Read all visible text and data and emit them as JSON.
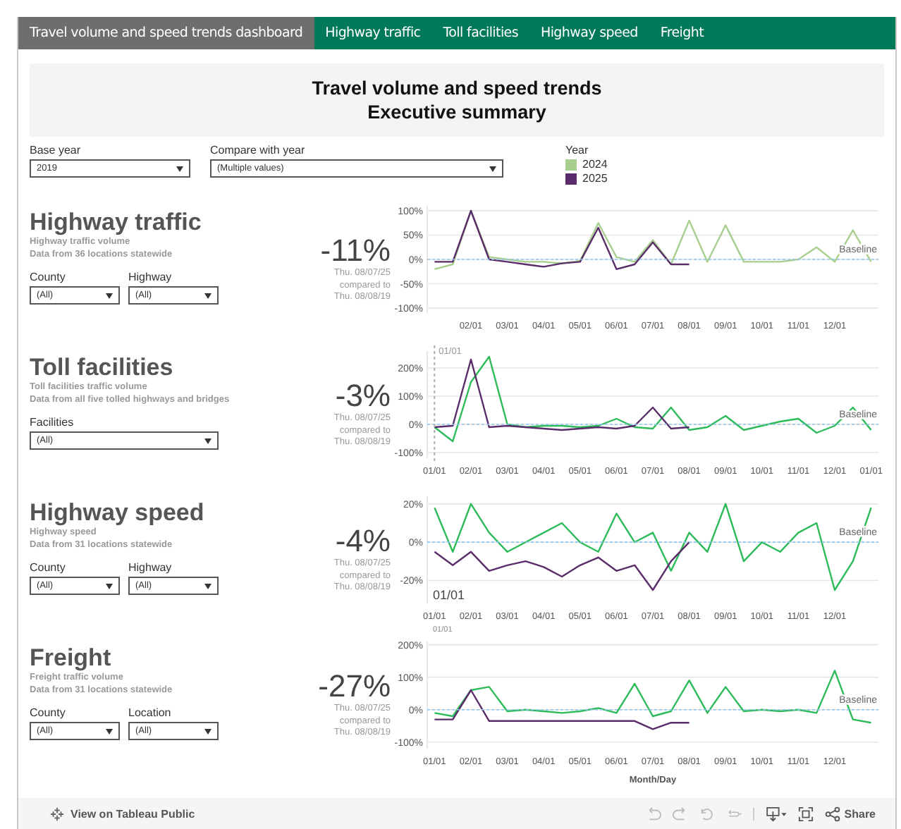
{
  "tabs": [
    {
      "label": "Travel volume and speed trends dashboard",
      "selected": true
    },
    {
      "label": "Highway traffic",
      "selected": false
    },
    {
      "label": "Toll facilities",
      "selected": false
    },
    {
      "label": "Highway speed",
      "selected": false
    },
    {
      "label": "Freight",
      "selected": false
    }
  ],
  "header": {
    "title": "Travel volume and speed trends",
    "subtitle": "Executive summary"
  },
  "filters": [
    {
      "label": "Base year",
      "value": "2019"
    },
    {
      "label": "Compare with year",
      "value": "(Multiple values)"
    }
  ],
  "legend": {
    "title": "Year",
    "items": [
      {
        "label": "2024",
        "color": "#a8cf8e"
      },
      {
        "label": "2025",
        "color": "#5a2d6a"
      }
    ]
  },
  "sections": [
    {
      "title": "Highway traffic",
      "subtitle": "Highway traffic volume",
      "note": "Data from 36 locations statewide",
      "filters": [
        {
          "label": "County",
          "value": "(All)"
        },
        {
          "label": "Highway",
          "value": "(All)"
        }
      ],
      "change": "-11%",
      "compare": [
        "Thu. 08/07/25",
        "compared to",
        "Thu. 08/08/19"
      ],
      "chart_data": {
        "type": "line",
        "grid": true,
        "ylim": [
          -110,
          110
        ],
        "categories": [
          null,
          null,
          "02/01",
          null,
          "03/01",
          null,
          "04/01",
          null,
          "05/01",
          null,
          "06/01",
          null,
          "07/01",
          null,
          "08/01",
          null,
          "09/01",
          null,
          "10/01",
          null,
          "11/01",
          null,
          "12/01",
          null,
          null
        ],
        "yticks": [
          {
            "value": 100,
            "label": "100%"
          },
          {
            "value": 50,
            "label": "50%"
          },
          {
            "value": 0,
            "label": "0%"
          },
          {
            "value": -50,
            "label": "-50%"
          },
          {
            "value": -100,
            "label": "-100%"
          }
        ],
        "series": [
          {
            "color": "#a8cf8e",
            "values": [
              -20,
              -10,
              100,
              5,
              0,
              -5,
              -5,
              -8,
              -3,
              75,
              5,
              -5,
              40,
              -10,
              80,
              -5,
              70,
              -5,
              -5,
              -5,
              0,
              25,
              -5,
              60,
              -5
            ]
          },
          {
            "color": "#5a2d6a",
            "values": [
              -5,
              -5,
              100,
              0,
              -5,
              -10,
              -15,
              -8,
              -5,
              65,
              -20,
              -10,
              35,
              -10,
              -10,
              null,
              null,
              null,
              null,
              null,
              null,
              null,
              null,
              null,
              null
            ]
          }
        ],
        "ref_lines": [
          {
            "axis": "y",
            "value": 0,
            "label": "Baseline"
          }
        ]
      }
    },
    {
      "title": "Toll facilities",
      "subtitle": "Toll facilities traffic volume",
      "note": "Data from all five tolled highways and bridges",
      "filters": [
        {
          "label": "Facilities",
          "value": "(All)"
        }
      ],
      "change": "-3%",
      "compare": [
        "Thu. 08/07/25",
        "compared to",
        "Thu. 08/08/19"
      ],
      "chart_data": {
        "type": "line",
        "grid": true,
        "ylim": [
          -120,
          260
        ],
        "categories": [
          "01/01",
          null,
          "02/01",
          null,
          "03/01",
          null,
          "04/01",
          null,
          "05/01",
          null,
          "06/01",
          null,
          "07/01",
          null,
          "08/01",
          null,
          "09/01",
          null,
          "10/01",
          null,
          "11/01",
          null,
          "12/01",
          null,
          "01/01"
        ],
        "yticks": [
          {
            "value": 200,
            "label": "200%"
          },
          {
            "value": 100,
            "label": "100%"
          },
          {
            "value": 0,
            "label": "0%"
          },
          {
            "value": -100,
            "label": "-100%"
          }
        ],
        "series": [
          {
            "color": "#2dbb5a",
            "values": [
              -10,
              -60,
              150,
              240,
              0,
              -10,
              -5,
              -5,
              -10,
              -5,
              20,
              -10,
              -15,
              60,
              -20,
              -10,
              30,
              -20,
              -5,
              10,
              20,
              -30,
              -5,
              60,
              -20
            ]
          },
          {
            "color": "#5a2d6a",
            "values": [
              -10,
              -5,
              230,
              -10,
              -5,
              -10,
              -15,
              -20,
              -15,
              -10,
              -15,
              -5,
              60,
              -15,
              -10,
              null,
              null,
              null,
              null,
              null,
              null,
              null,
              null,
              null,
              null
            ]
          }
        ],
        "ref_lines": [
          {
            "axis": "y",
            "value": 0,
            "label": "Baseline"
          },
          {
            "axis": "x",
            "value": "01/01",
            "label": "01/01"
          }
        ]
      }
    },
    {
      "title": "Highway speed",
      "subtitle": "Highway speed",
      "note": "Data from 31 locations statewide",
      "filters": [
        {
          "label": "County",
          "value": "(All)"
        },
        {
          "label": "Highway",
          "value": "(All)"
        }
      ],
      "change": "-4%",
      "compare": [
        "Thu. 08/07/25",
        "compared to",
        "Thu. 08/08/19"
      ],
      "chart_data": {
        "type": "line",
        "grid": true,
        "ylim": [
          -32,
          24
        ],
        "categories": [
          "01/01",
          null,
          "02/01",
          null,
          "03/01",
          null,
          "04/01",
          null,
          "05/01",
          null,
          "06/01",
          null,
          "07/01",
          null,
          "08/01",
          null,
          "09/01",
          null,
          "10/01",
          null,
          "11/01",
          null,
          "12/01",
          null,
          null
        ],
        "yticks": [
          {
            "value": 20,
            "label": "20%"
          },
          {
            "value": 0,
            "label": "0%"
          },
          {
            "value": -20,
            "label": "-20%"
          }
        ],
        "series": [
          {
            "color": "#2dbb5a",
            "values": [
              18,
              -5,
              20,
              5,
              -5,
              0,
              5,
              10,
              0,
              -5,
              15,
              0,
              5,
              -15,
              5,
              -5,
              20,
              -10,
              0,
              -5,
              5,
              10,
              -25,
              -10,
              18
            ]
          },
          {
            "color": "#5a2d6a",
            "values": [
              -5,
              -12,
              -5,
              -15,
              -12,
              -10,
              -13,
              -18,
              -12,
              -8,
              -15,
              -12,
              -25,
              -10,
              0,
              null,
              null,
              null,
              null,
              null,
              null,
              null,
              null,
              null,
              null
            ]
          }
        ],
        "ref_lines": [
          {
            "axis": "y",
            "value": 0,
            "label": "Baseline"
          }
        ],
        "annotations": [
          "01/01"
        ]
      },
      "sub_label": "01/01"
    },
    {
      "title": "Freight",
      "subtitle": "Freight traffic volume",
      "note": "Data from 31 locations statewide",
      "filters": [
        {
          "label": "County",
          "value": "(All)"
        },
        {
          "label": "Location",
          "value": "(All)"
        }
      ],
      "change": "-27%",
      "compare": [
        "Thu. 08/07/25",
        "compared to",
        "Thu. 08/08/19"
      ],
      "chart_data": {
        "type": "line",
        "grid": true,
        "ylim": [
          -120,
          210
        ],
        "xlabel": "Month/Day",
        "categories": [
          "01/01",
          null,
          "02/01",
          null,
          "03/01",
          null,
          "04/01",
          null,
          "05/01",
          null,
          "06/01",
          null,
          "07/01",
          null,
          "08/01",
          null,
          "09/01",
          null,
          "10/01",
          null,
          "11/01",
          null,
          "12/01",
          null,
          null
        ],
        "yticks": [
          {
            "value": 200,
            "label": "200%"
          },
          {
            "value": 100,
            "label": "100%"
          },
          {
            "value": 0,
            "label": "0%"
          },
          {
            "value": -100,
            "label": "-100%"
          }
        ],
        "series": [
          {
            "color": "#2dbb5a",
            "values": [
              -10,
              -20,
              60,
              70,
              -5,
              0,
              -5,
              -10,
              -5,
              5,
              -10,
              80,
              -20,
              -5,
              90,
              -10,
              70,
              -5,
              0,
              -5,
              0,
              -10,
              120,
              -30,
              -40
            ]
          },
          {
            "color": "#5a2d6a",
            "values": [
              -30,
              -30,
              60,
              -35,
              -35,
              -35,
              -35,
              -35,
              -35,
              -35,
              -35,
              -35,
              -60,
              -40,
              -40,
              null,
              null,
              null,
              null,
              null,
              null,
              null,
              null,
              null,
              null
            ]
          }
        ],
        "ref_lines": [
          {
            "axis": "y",
            "value": 0,
            "label": "Baseline"
          }
        ]
      }
    }
  ],
  "footer": {
    "link": "View on Tableau Public",
    "share": "Share"
  }
}
